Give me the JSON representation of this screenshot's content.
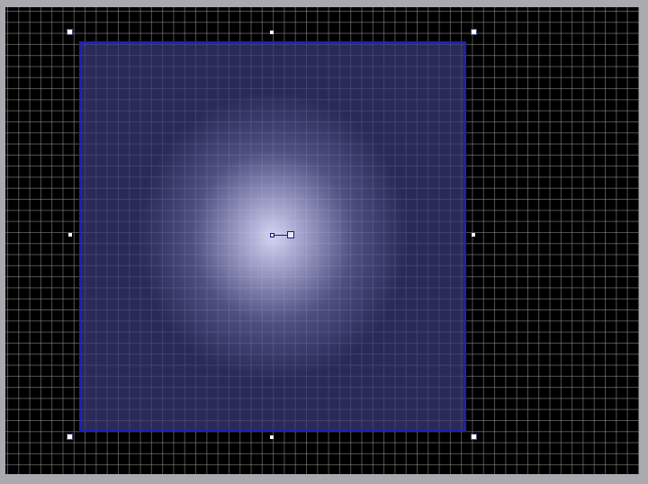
{
  "canvas": {
    "background_color": "#000000",
    "grid_color": "#969696",
    "grid_visible": true
  },
  "shape": {
    "type": "rectangle",
    "fill": "radial-gradient",
    "stroke_color": "#2020b8",
    "gradient_center_color": "#e1e1ff",
    "gradient_edge_color": "#3c3c7d",
    "selected": true
  },
  "selection": {
    "handles": [
      "top-left",
      "top-center",
      "top-right",
      "middle-left",
      "middle-right",
      "bottom-left",
      "bottom-center",
      "bottom-right"
    ]
  },
  "gradient_tool": {
    "handles": [
      "gradient-center-handle",
      "gradient-radius-handle"
    ]
  }
}
